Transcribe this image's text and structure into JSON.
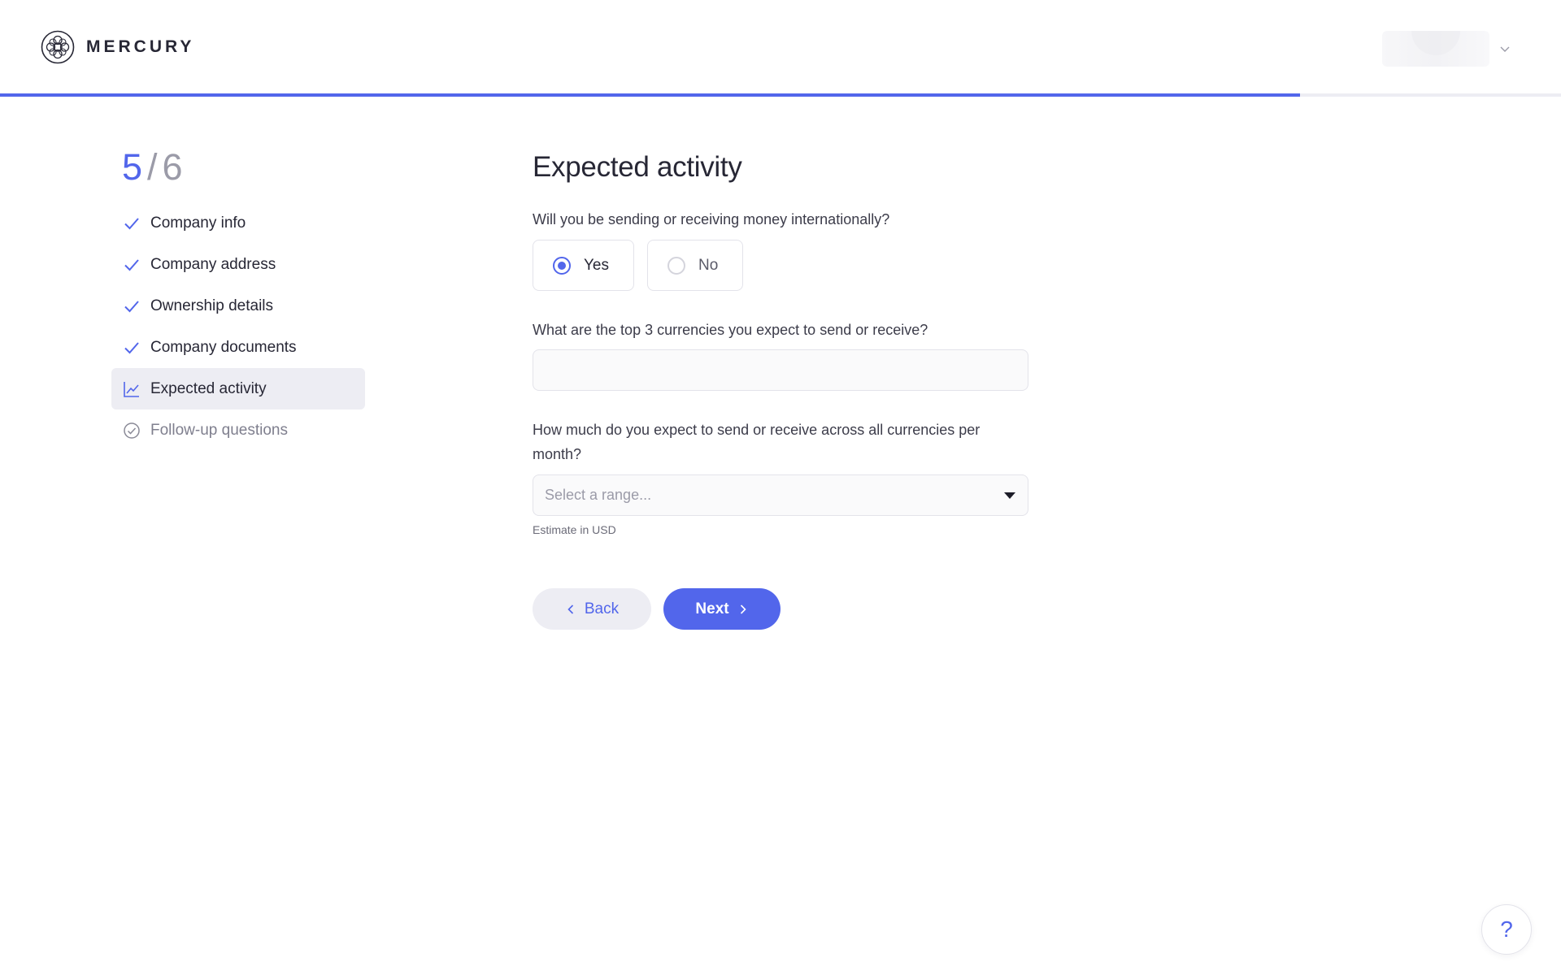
{
  "brand": {
    "name": "MERCURY",
    "logo_icon": "mercury-logo-icon"
  },
  "header": {
    "account_chevron_icon": "chevron-down-icon"
  },
  "progress": {
    "fraction": 0.833,
    "color": "#5266eb"
  },
  "sidebar": {
    "step_current": "5",
    "step_separator": "/",
    "step_total": "6",
    "items": [
      {
        "label": "Company info",
        "status": "done",
        "icon": "check-icon"
      },
      {
        "label": "Company address",
        "status": "done",
        "icon": "check-icon"
      },
      {
        "label": "Ownership details",
        "status": "done",
        "icon": "check-icon"
      },
      {
        "label": "Company documents",
        "status": "done",
        "icon": "check-icon"
      },
      {
        "label": "Expected activity",
        "status": "active",
        "icon": "chart-line-icon"
      },
      {
        "label": "Follow-up questions",
        "status": "pending",
        "icon": "circle-check-icon"
      }
    ]
  },
  "form": {
    "title": "Expected activity",
    "international_question": "Will you be sending or receiving money internationally?",
    "options": {
      "yes": "Yes",
      "no": "No",
      "selected": "Yes"
    },
    "currencies_question": "What are the top 3 currencies you expect to send or receive?",
    "currencies_value": "",
    "volume_question": "How much do you expect to send or receive across all currencies per month?",
    "volume_placeholder": "Select a range...",
    "volume_hint": "Estimate in USD",
    "back_label": "Back",
    "next_label": "Next"
  },
  "help": {
    "label": "?"
  },
  "colors": {
    "accent": "#5266eb",
    "text": "#272735",
    "muted": "#9b9ba8"
  }
}
